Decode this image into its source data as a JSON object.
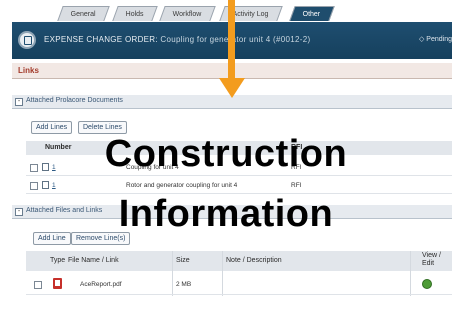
{
  "tabs": [
    {
      "label": "General"
    },
    {
      "label": "Holds"
    },
    {
      "label": "Workflow"
    },
    {
      "label": "Activity Log"
    },
    {
      "label": "Other"
    }
  ],
  "header": {
    "title": "EXPENSE CHANGE ORDER:",
    "subtitle": "Coupling for generator unit 4 (#0012-2)",
    "status": "Pending"
  },
  "links": {
    "label": "Links",
    "attached_docs": {
      "label": "Attached Prolacore Documents",
      "buttons": {
        "add": "Add Lines",
        "delete": "Delete Lines"
      },
      "columns": {
        "number": "Number",
        "type": "RFI"
      },
      "rows": [
        {
          "number": "1",
          "description": "Coupling for unit 4",
          "type": "RFI"
        },
        {
          "number": "1",
          "description": "Rotor and generator coupling for unit 4",
          "type": "RFI"
        }
      ]
    },
    "attached_files": {
      "label": "Attached Files and Links",
      "buttons": {
        "add": "Add Line",
        "remove": "Remove Line(s)"
      },
      "columns": {
        "type": "Type",
        "file": "File Name / Link",
        "size": "Size",
        "note": "Note / Description",
        "view": "View / Edit"
      },
      "rows": [
        {
          "file": "AceReport.pdf",
          "size": "2 MB",
          "note": ""
        }
      ]
    }
  },
  "overlay": {
    "line1": "Construction",
    "line2": "Information"
  },
  "colors": {
    "arrow": "#f39c1e",
    "header": "#1e4e70",
    "links_label": "#a33a2a"
  }
}
